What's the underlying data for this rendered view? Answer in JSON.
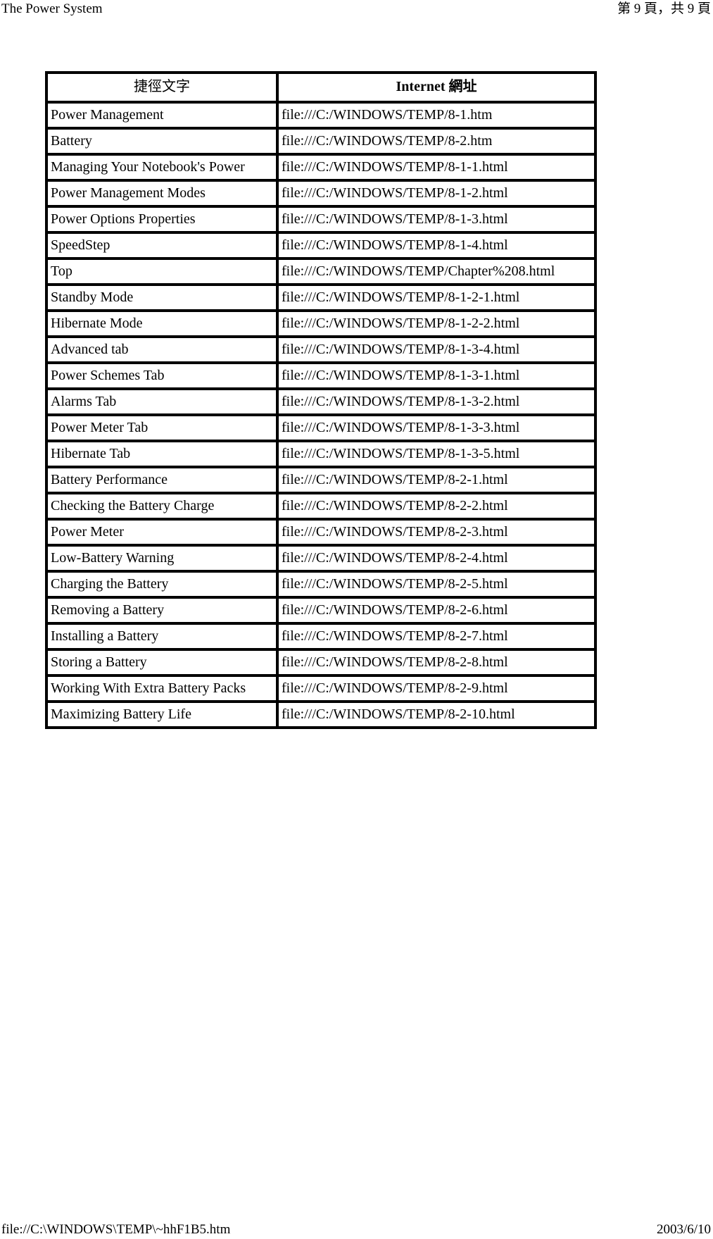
{
  "header": {
    "document_title": "The Power System",
    "page_indicator": "第 9 頁，共 9 頁"
  },
  "footer": {
    "source_path": "file://C:\\WINDOWS\\TEMP\\~hhF1B5.htm",
    "print_date": "2003/6/10"
  },
  "table": {
    "columns": [
      {
        "label": "捷徑文字"
      },
      {
        "label": "Internet 網址"
      }
    ],
    "rows": [
      {
        "text": "Power Management",
        "url": "file:///C:/WINDOWS/TEMP/8-1.htm"
      },
      {
        "text": "Battery",
        "url": "file:///C:/WINDOWS/TEMP/8-2.htm"
      },
      {
        "text": "Managing Your Notebook's Power",
        "url": "file:///C:/WINDOWS/TEMP/8-1-1.html"
      },
      {
        "text": "Power Management Modes",
        "url": "file:///C:/WINDOWS/TEMP/8-1-2.html"
      },
      {
        "text": "Power Options Properties",
        "url": "file:///C:/WINDOWS/TEMP/8-1-3.html"
      },
      {
        "text": "SpeedStep",
        "url": "file:///C:/WINDOWS/TEMP/8-1-4.html"
      },
      {
        "text": "Top",
        "url": "file:///C:/WINDOWS/TEMP/Chapter%208.html"
      },
      {
        "text": "Standby Mode",
        "url": "file:///C:/WINDOWS/TEMP/8-1-2-1.html"
      },
      {
        "text": "Hibernate Mode",
        "url": "file:///C:/WINDOWS/TEMP/8-1-2-2.html"
      },
      {
        "text": "Advanced tab",
        "url": "file:///C:/WINDOWS/TEMP/8-1-3-4.html"
      },
      {
        "text": "Power Schemes Tab",
        "url": "file:///C:/WINDOWS/TEMP/8-1-3-1.html"
      },
      {
        "text": "Alarms Tab",
        "url": "file:///C:/WINDOWS/TEMP/8-1-3-2.html"
      },
      {
        "text": "Power Meter Tab",
        "url": "file:///C:/WINDOWS/TEMP/8-1-3-3.html"
      },
      {
        "text": "Hibernate Tab",
        "url": "file:///C:/WINDOWS/TEMP/8-1-3-5.html"
      },
      {
        "text": "Battery Performance",
        "url": "file:///C:/WINDOWS/TEMP/8-2-1.html"
      },
      {
        "text": "Checking the Battery Charge",
        "url": "file:///C:/WINDOWS/TEMP/8-2-2.html"
      },
      {
        "text": "Power Meter",
        "url": "file:///C:/WINDOWS/TEMP/8-2-3.html"
      },
      {
        "text": "Low-Battery Warning",
        "url": "file:///C:/WINDOWS/TEMP/8-2-4.html"
      },
      {
        "text": "Charging the Battery",
        "url": "file:///C:/WINDOWS/TEMP/8-2-5.html"
      },
      {
        "text": "Removing a Battery",
        "url": "file:///C:/WINDOWS/TEMP/8-2-6.html"
      },
      {
        "text": "Installing a Battery",
        "url": "file:///C:/WINDOWS/TEMP/8-2-7.html"
      },
      {
        "text": "Storing a Battery",
        "url": "file:///C:/WINDOWS/TEMP/8-2-8.html"
      },
      {
        "text": "Working With Extra Battery Packs",
        "url": "file:///C:/WINDOWS/TEMP/8-2-9.html"
      },
      {
        "text": "Maximizing Battery Life",
        "url": "file:///C:/WINDOWS/TEMP/8-2-10.html"
      }
    ]
  }
}
